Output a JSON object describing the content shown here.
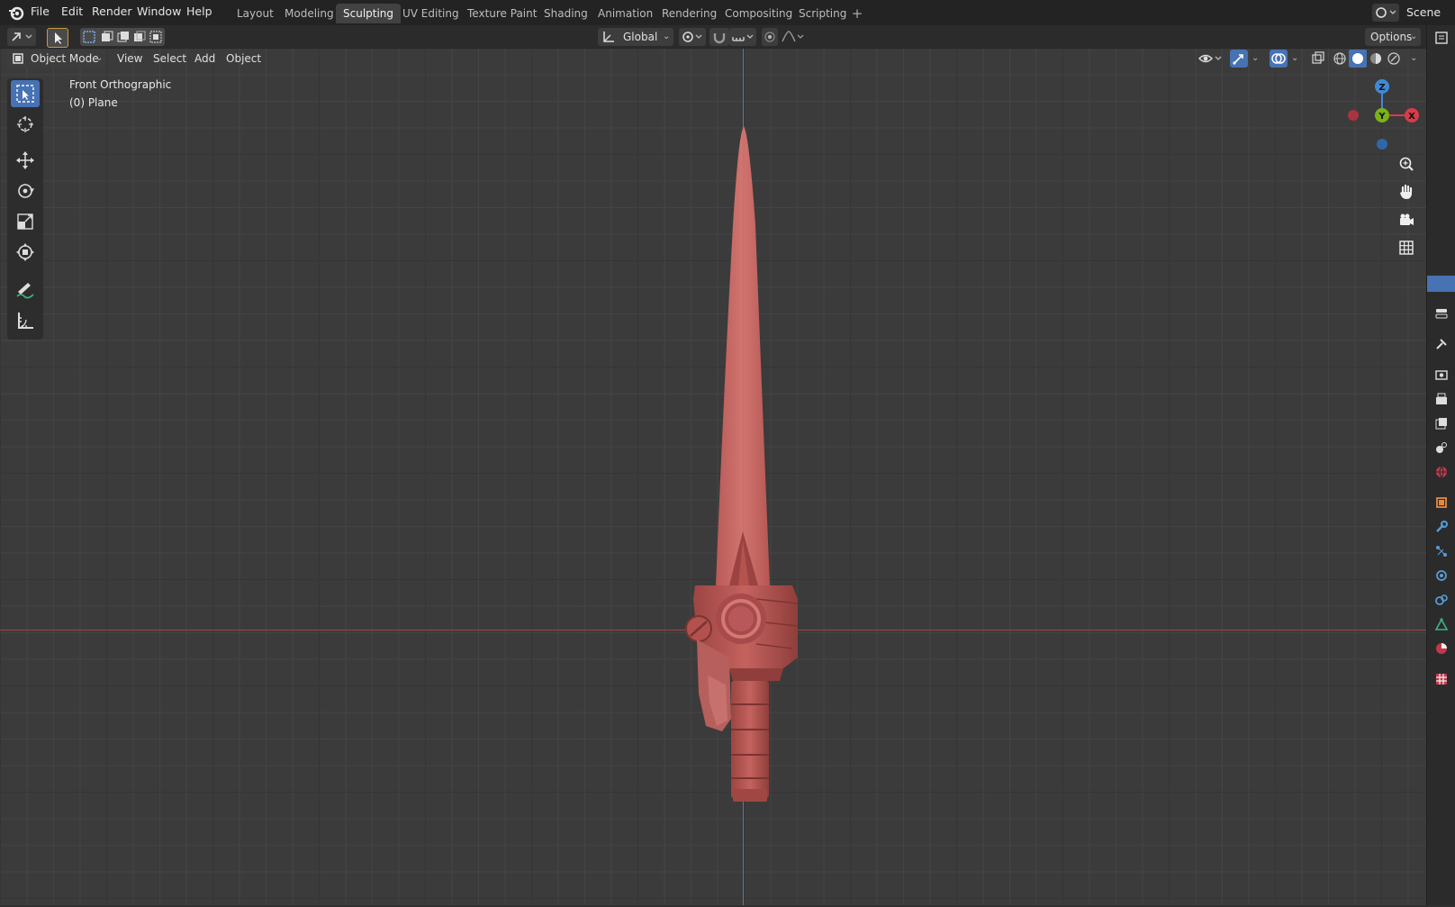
{
  "menu": {
    "file": "File",
    "edit": "Edit",
    "render": "Render",
    "window": "Window",
    "help": "Help"
  },
  "workspaces": [
    {
      "label": "Layout"
    },
    {
      "label": "Modeling"
    },
    {
      "label": "Sculpting"
    },
    {
      "label": "UV Editing"
    },
    {
      "label": "Texture Paint"
    },
    {
      "label": "Shading"
    },
    {
      "label": "Animation"
    },
    {
      "label": "Rendering"
    },
    {
      "label": "Compositing"
    },
    {
      "label": "Scripting"
    }
  ],
  "active_workspace": "Sculpting",
  "add_workspace": "+",
  "scene": {
    "name": "Scene"
  },
  "toolheader": {
    "transform_orientation": "Global",
    "options": "Options"
  },
  "viewheader": {
    "mode": "Object Mode",
    "view": "View",
    "select": "Select",
    "add": "Add",
    "object": "Object"
  },
  "viewport": {
    "view_name": "Front Orthographic",
    "object_info": "(0) Plane"
  },
  "gizmo": {
    "z": "Z",
    "y": "Y",
    "x": "X"
  },
  "colors": {
    "accent": "#4772b3",
    "model": "#c96a66",
    "x_axis": "#d93b4a",
    "y_axis": "#79b319",
    "z_axis": "#3d8bd6"
  },
  "left_tools": [
    "select-box-icon",
    "cursor-icon",
    "move-icon",
    "rotate-icon",
    "scale-icon",
    "transform-icon",
    "annotate-icon",
    "measure-icon"
  ],
  "nav_gizmos": [
    "zoom-icon",
    "pan-hand-icon",
    "camera-icon",
    "grid-ortho-icon"
  ]
}
